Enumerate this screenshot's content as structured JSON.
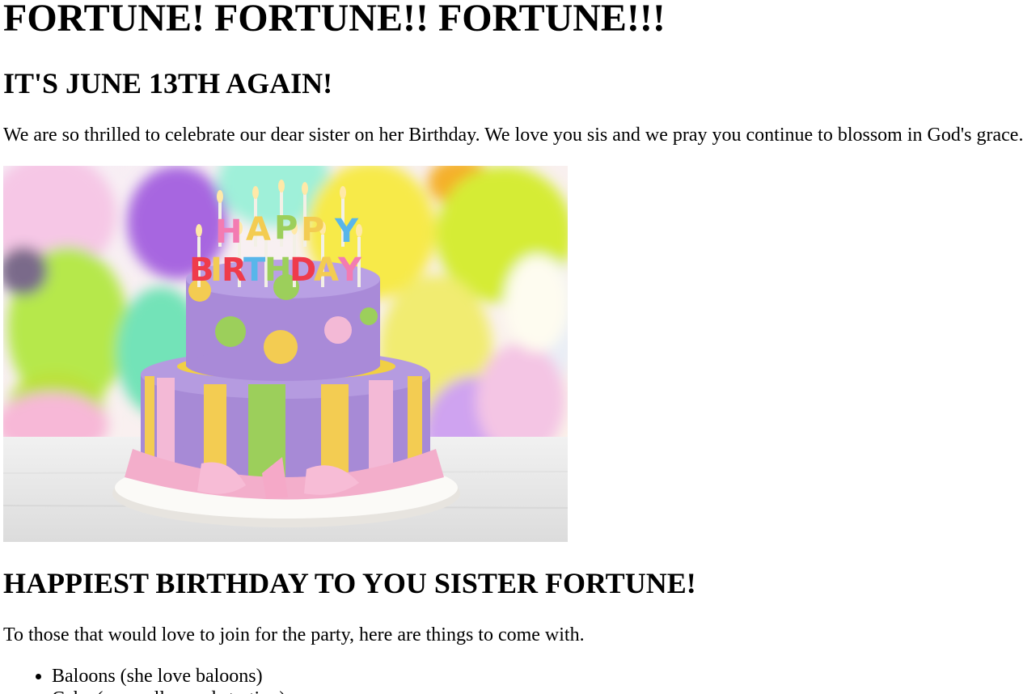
{
  "title": "FORTUNE! FORTUNE!! FORTUNE!!!",
  "subtitle": "IT'S JUNE 13TH AGAIN!",
  "intro": "We are so thrilled to celebrate our dear sister on her Birthday. We love you sis and we pray you continue to blossom in God's grace.",
  "image": {
    "description_icon": "birthday-cake-with-balloons",
    "candle_text_top": "HAPPY",
    "candle_text_bottom": "BIRTHDAY"
  },
  "section_heading": "HAPPIEST BIRTHDAY TO YOU SISTER FORTUNE!",
  "party_text": "To those that would love to join for the party, here are things to come with.",
  "items": [
    "Baloons (she love baloons)",
    "Cake (we really need starting)"
  ]
}
